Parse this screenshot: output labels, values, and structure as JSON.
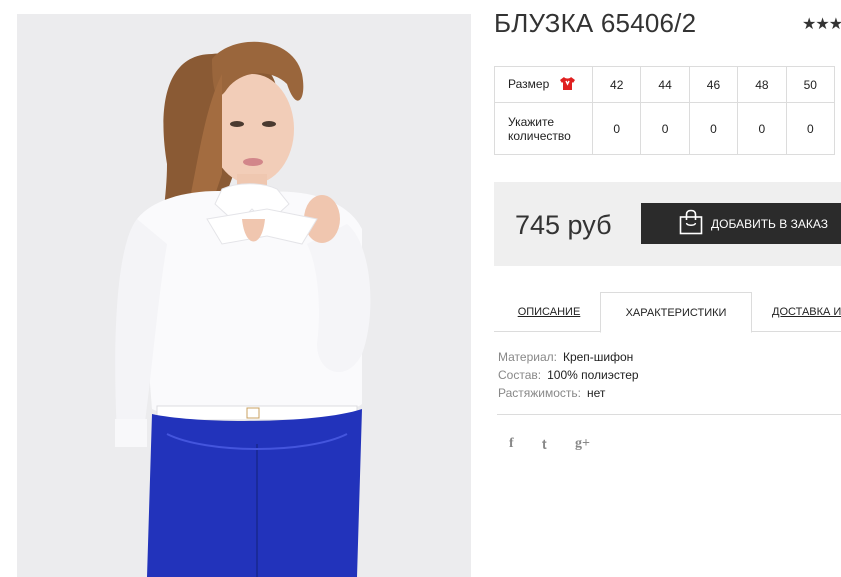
{
  "product": {
    "title": "БЛУЗКА 65406/2",
    "rating_stars": "★★★",
    "price": "745 руб"
  },
  "size_table": {
    "size_label": "Размер",
    "qty_label_line1": "Укажите",
    "qty_label_line2": "количество",
    "sizes": [
      "42",
      "44",
      "46",
      "48",
      "50"
    ],
    "quantities": [
      "0",
      "0",
      "0",
      "0",
      "0"
    ]
  },
  "actions": {
    "add_to_order_label": "ДОБАВИТЬ В ЗАКАЗ"
  },
  "tabs": [
    {
      "label": "ОПИСАНИЕ",
      "active": false
    },
    {
      "label": "ХАРАКТЕРИСТИКИ",
      "active": true
    },
    {
      "label": "ДОСТАВКА И",
      "active": false
    }
  ],
  "specs": [
    {
      "key": "Материал:",
      "value": "Креп-шифон"
    },
    {
      "key": "Состав:",
      "value": "100% полиэстер"
    },
    {
      "key": "Растяжимость:",
      "value": "нет"
    }
  ],
  "social": {
    "facebook": "f",
    "twitter": "t",
    "googleplus": "g+"
  },
  "icons": {
    "size_chart": "tshirt-icon",
    "add_button": "shopping-bag-icon"
  },
  "colors": {
    "button_bg": "#2b2b2b",
    "buybox_bg": "#efefef",
    "size_icon": "#e02020"
  }
}
